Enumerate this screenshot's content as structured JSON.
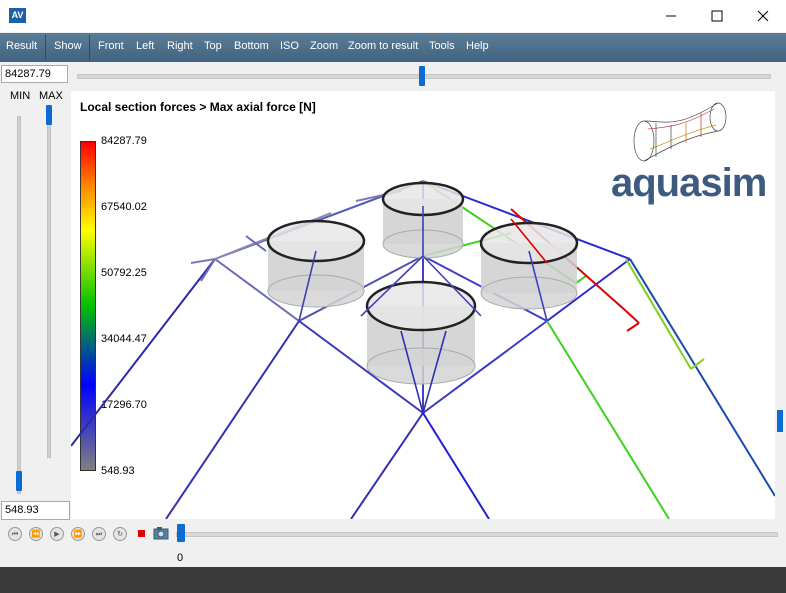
{
  "window": {
    "icon_label": "AV"
  },
  "menu": {
    "items": [
      "Result",
      "Show",
      "Front",
      "Left",
      "Right",
      "Top",
      "Bottom",
      "ISO",
      "Zoom",
      "Zoom to result",
      "Tools",
      "Help"
    ]
  },
  "range": {
    "max_value": "84287.79",
    "min_value": "548.93",
    "min_label": "MIN",
    "max_label": "MAX"
  },
  "viewport": {
    "title": "Local section forces > Max axial force [N]"
  },
  "colorbar": {
    "ticks": [
      "84287.79",
      "67540.02",
      "50792.25",
      "34044.47",
      "17296.70",
      "548.93"
    ],
    "colors": [
      "#ff0000",
      "#ff8c00",
      "#ffff00",
      "#00c000",
      "#0000ff",
      "#808080"
    ]
  },
  "logo": {
    "text": "aquasim"
  },
  "timeline": {
    "value": "0"
  },
  "icons": {
    "first": "skip-first-icon",
    "prev": "step-back-icon",
    "play": "play-icon",
    "next": "step-forward-icon",
    "last": "skip-last-icon",
    "loop": "loop-icon",
    "record": "record-icon",
    "camera": "camera-icon"
  }
}
